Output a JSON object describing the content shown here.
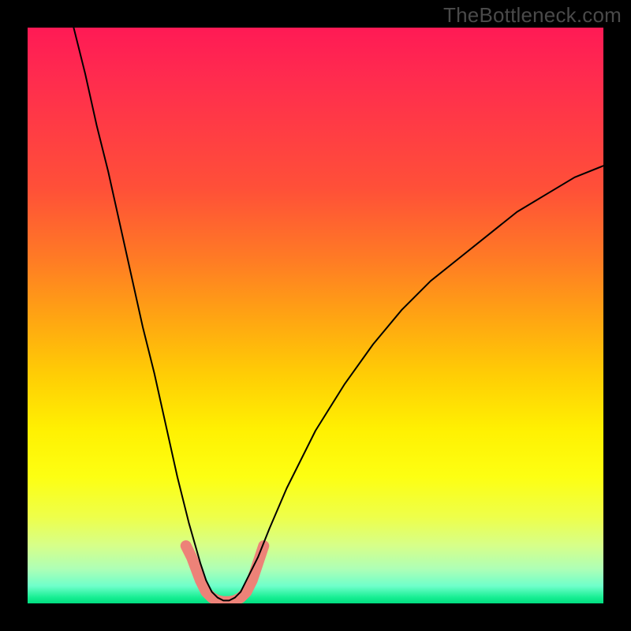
{
  "watermark": "TheBottleneck.com",
  "chart_data": {
    "type": "line",
    "title": "",
    "xlabel": "",
    "ylabel": "",
    "xlim": [
      0,
      100
    ],
    "ylim": [
      0,
      100
    ],
    "background_gradient": {
      "orientation": "vertical",
      "stops": [
        {
          "pos": 0,
          "color": "#ff1a55"
        },
        {
          "pos": 50,
          "color": "#ffa313"
        },
        {
          "pos": 78,
          "color": "#fdff12"
        },
        {
          "pos": 100,
          "color": "#00dd80"
        }
      ]
    },
    "series": [
      {
        "name": "bottleneck-curve",
        "color": "#000000",
        "stroke_width": 2,
        "x": [
          8,
          10,
          12,
          14,
          16,
          18,
          20,
          22,
          24,
          26,
          28,
          30,
          31,
          32,
          33,
          34,
          35,
          36,
          37,
          38,
          40,
          42,
          45,
          50,
          55,
          60,
          65,
          70,
          75,
          80,
          85,
          90,
          95,
          100
        ],
        "values": [
          100,
          92,
          83,
          75,
          66,
          57,
          48,
          40,
          31,
          22,
          14,
          7,
          4,
          2,
          1,
          0.5,
          0.5,
          1,
          2,
          4,
          8,
          13,
          20,
          30,
          38,
          45,
          51,
          56,
          60,
          64,
          68,
          71,
          74,
          76
        ]
      },
      {
        "name": "highlight-band",
        "color": "#ed8278",
        "stroke_width": 14,
        "x": [
          27.5,
          28.5,
          30,
          31,
          32,
          33,
          34,
          35,
          36,
          37,
          38,
          39,
          40,
          41
        ],
        "values": [
          10,
          8,
          4,
          2,
          1,
          0.5,
          0.3,
          0.3,
          0.5,
          1,
          2,
          4,
          7,
          10
        ]
      }
    ],
    "annotations": []
  }
}
